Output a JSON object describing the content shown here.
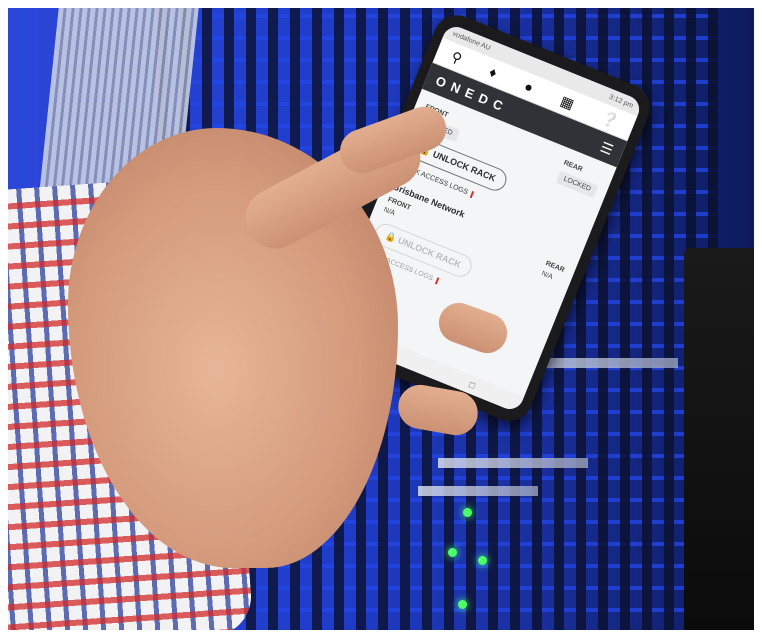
{
  "phone": {
    "status_left": "vodafone AU",
    "status_right": "3:12 pm",
    "icons": [
      "search-icon",
      "bell-icon",
      "user-icon",
      "windows-icon",
      "help-icon"
    ],
    "brand": "ONEDC",
    "rack1": {
      "front_label": "FRONT",
      "front_status": "LOCKED",
      "rear_label": "REAR",
      "rear_status": "LOCKED",
      "unlock_label": "UNLOCK RACK",
      "logs_label": "RACK ACCESS LOGS"
    },
    "rack2": {
      "name": "Brisbane Network",
      "front_label": "FRONT",
      "front_status": "N/A",
      "rear_label": "REAR",
      "rear_status": "N/A",
      "unlock_label": "UNLOCK RACK",
      "logs_label": "RACK ACCESS LOGS"
    }
  },
  "colors": {
    "rack_blue": "#2340d4",
    "header_dark": "#2f3237",
    "accent_red": "#d0342c",
    "led_green": "#4cff6a"
  }
}
